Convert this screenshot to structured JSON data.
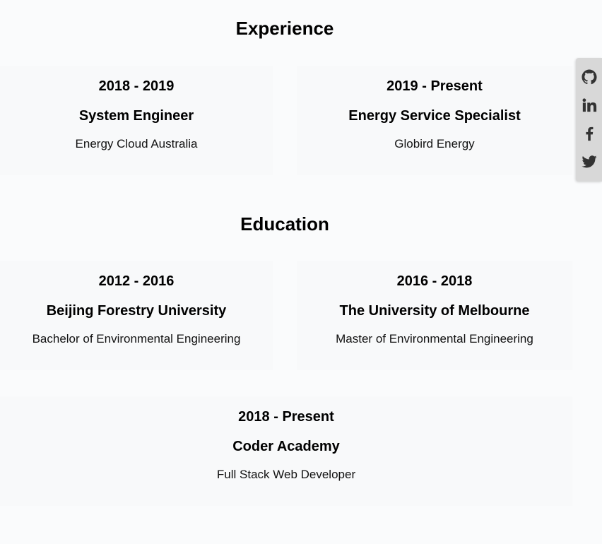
{
  "experience": {
    "title": "Experience",
    "items": [
      {
        "period": "2018 - 2019",
        "role": "System Engineer",
        "org": "Energy Cloud Australia"
      },
      {
        "period": "2019 - Present",
        "role": "Energy Service Specialist",
        "org": "Globird Energy"
      }
    ]
  },
  "education": {
    "title": "Education",
    "items": [
      {
        "period": "2012 - 2016",
        "school": "Beijing Forestry University",
        "degree": "Bachelor of Environmental Engineering"
      },
      {
        "period": "2016 - 2018",
        "school": "The University of Melbourne",
        "degree": "Master of Environmental Engineering"
      },
      {
        "period": "2018 - Present",
        "school": "Coder Academy",
        "degree": "Full Stack Web Developer"
      }
    ]
  },
  "social": {
    "icons": [
      "github-icon",
      "linkedin-icon",
      "facebook-icon",
      "twitter-icon"
    ]
  },
  "colors": {
    "background": "#fafbfc",
    "card": "#f8f9fa",
    "social_bar": "#d8d8d8",
    "icon": "#333333"
  }
}
